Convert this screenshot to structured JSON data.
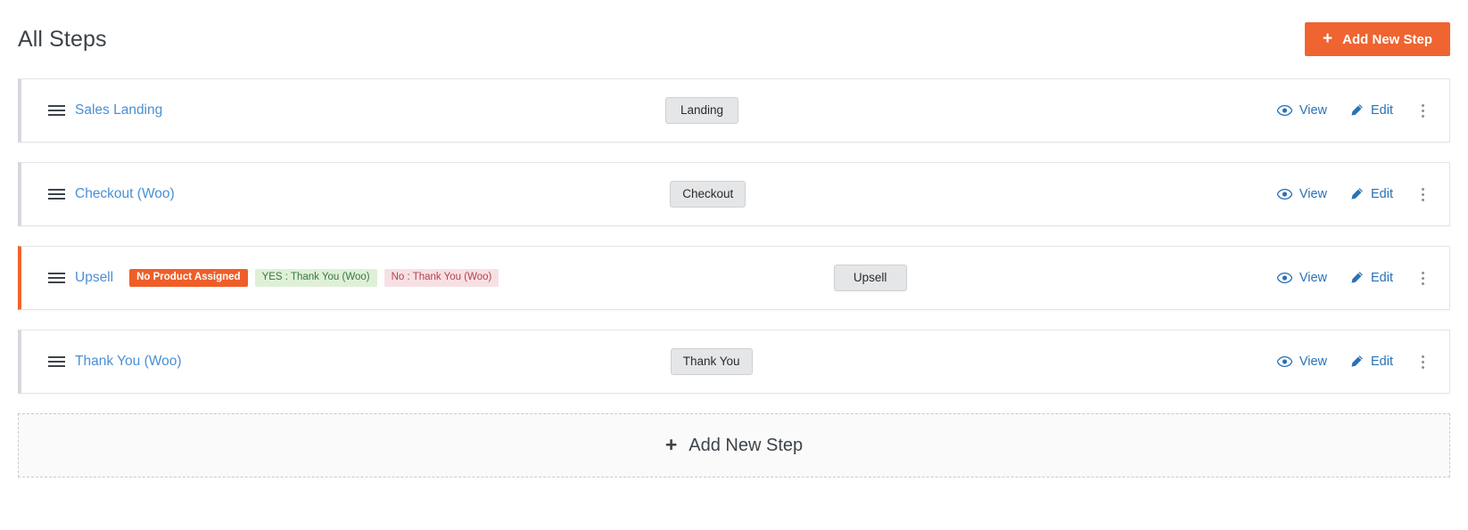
{
  "header": {
    "title": "All Steps",
    "add_button": {
      "label": "Add New Step",
      "icon": "plus-icon",
      "plus": "+",
      "color": "#ef6430"
    }
  },
  "steps": [
    {
      "name": "Sales Landing",
      "type_badge": "Landing",
      "tags": [],
      "accent": false,
      "accent_color": "#d5d8dc",
      "actions": {
        "view": "View",
        "edit": "Edit",
        "more": "more-options"
      }
    },
    {
      "name": "Checkout (Woo)",
      "type_badge": "Checkout",
      "tags": [],
      "accent": false,
      "accent_color": "#d5d8dc",
      "actions": {
        "view": "View",
        "edit": "Edit",
        "more": "more-options"
      }
    },
    {
      "name": "Upsell",
      "type_badge": "Upsell",
      "tags": [
        {
          "label": "No Product Assigned",
          "style": "danger",
          "bg": "#ef5e28",
          "fg": "#ffffff"
        },
        {
          "label": "YES : Thank You (Woo)",
          "style": "yes",
          "bg": "#dff0d8",
          "fg": "#3c763d"
        },
        {
          "label": "No : Thank You (Woo)",
          "style": "no",
          "bg": "#f7e0e3",
          "fg": "#b3444f"
        }
      ],
      "accent": true,
      "accent_color": "#ef6430",
      "actions": {
        "view": "View",
        "edit": "Edit",
        "more": "more-options"
      }
    },
    {
      "name": "Thank You (Woo)",
      "type_badge": "Thank You",
      "tags": [],
      "accent": false,
      "accent_color": "#d5d8dc",
      "actions": {
        "view": "View",
        "edit": "Edit",
        "more": "more-options"
      }
    }
  ],
  "add_new_block": {
    "label": "Add New Step",
    "plus": "+",
    "icon": "plus-icon"
  },
  "icons": {
    "drag": "drag-handle-icon",
    "view": "eye-icon",
    "edit": "pencil-icon",
    "more": "kebab-menu-icon"
  }
}
